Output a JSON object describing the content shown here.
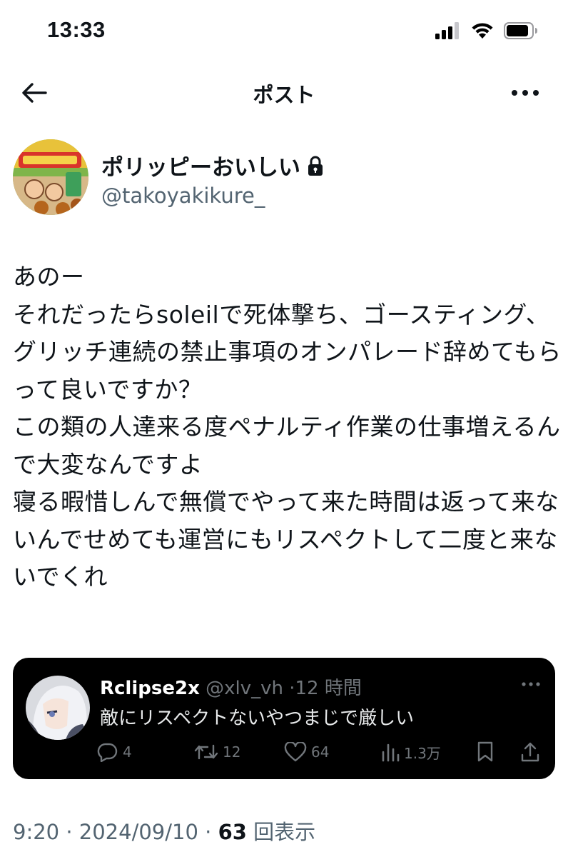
{
  "status_bar": {
    "time": "13:33"
  },
  "nav": {
    "title": "ポスト"
  },
  "author": {
    "display_name": "ポリッピーおいしい",
    "handle": "@takoyakikure_"
  },
  "post": {
    "text": "あのー\nそれだったらsoleilで死体撃ち、ゴースティング、グリッチ連続の禁止事項のオンパレード辞めてもらって良いですか？\nこの類の人達来る度ペナルティ作業の仕事増えるんで大変なんですよ\n寝る暇惜しんで無償でやって来た時間は返って来ないんでせめても運営にもリスペクトして二度と来ないでくれ"
  },
  "quoted_post": {
    "display_name": "Rclipse2x",
    "handle": "@xlv_vh",
    "separator": "·",
    "time_ago": "12 時間",
    "text": "敵にリスペクトないやつまじで厳しい",
    "replies": "4",
    "reposts": "12",
    "likes": "64",
    "views": "1.3万"
  },
  "footer": {
    "time": "9:20",
    "separator1": " · ",
    "date": "2024/09/10",
    "separator2": " · ",
    "views_count": "63",
    "views_label": " 回表示"
  },
  "colors": {
    "text": "#0f1419",
    "secondary": "#536471",
    "quote_bg": "#000000",
    "quote_meta": "#71767b"
  },
  "icons": [
    "signal-icon",
    "wifi-icon",
    "battery-icon",
    "back-arrow-icon",
    "more-icon",
    "lock-icon",
    "reply-icon",
    "repost-icon",
    "like-icon",
    "views-icon",
    "bookmark-icon",
    "share-icon"
  ]
}
